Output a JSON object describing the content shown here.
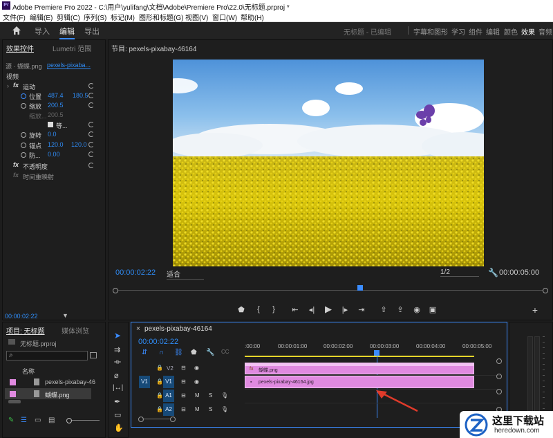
{
  "window": {
    "title": "Adobe Premiere Pro 2022 - C:\\用户\\yulifang\\文档\\Adobe\\Premiere Pro\\22.0\\无标题.prproj *",
    "app_icon": "Pr"
  },
  "menu": [
    "文件(F)",
    "编辑(E)",
    "剪辑(C)",
    "序列(S)",
    "标记(M)",
    "图形和标题(G)",
    "视图(V)",
    "窗口(W)",
    "帮助(H)"
  ],
  "workspace": {
    "tabs": [
      "导入",
      "编辑",
      "导出"
    ],
    "active_tab": "编辑",
    "project_status": "无标题 - 已编辑",
    "right_tabs": [
      "字幕和图形",
      "学习",
      "组件",
      "编辑",
      "颜色",
      "效果",
      "音频"
    ],
    "right_active": "效果"
  },
  "effect_controls": {
    "tabs": [
      "效果控件",
      "Lumetri 范围"
    ],
    "source": "源 · 蝴蝶.png",
    "seq": "pexels-pixaba...",
    "section": "视频",
    "motion": "运动",
    "properties": [
      {
        "label": "位置",
        "v1": "487.4",
        "v2": "180.5"
      },
      {
        "label": "缩放",
        "v1": "200.5"
      },
      {
        "label": "缩放...",
        "v1": "200.5"
      },
      {
        "label": "等...",
        "v1": ""
      },
      {
        "label": "旋转",
        "v1": "0.0"
      },
      {
        "label": "锚点",
        "v1": "120.0",
        "v2": "120.0"
      },
      {
        "label": "防...",
        "v1": "0.00"
      }
    ],
    "opacity": "不透明度",
    "time_remap": "时间重映射",
    "timecode": "00:00:02:22"
  },
  "program": {
    "label": "节目: pexels-pixabay-46164",
    "timecode": "00:00:02:22",
    "fit": "适合",
    "quality": "1/2",
    "duration": "00:00:05:00"
  },
  "project": {
    "tabs": [
      "项目: 无标题",
      "媒体浏览"
    ],
    "file": "无标题.prproj",
    "search_placeholder": "",
    "name_header": "名称",
    "items": [
      {
        "name": "pexels-pixabay-46",
        "color": "#e08ae0"
      },
      {
        "name": "蝴蝶.png",
        "color": "#e08ae0"
      }
    ]
  },
  "timeline": {
    "tab": "pexels-pixabay-46164",
    "timecode": "00:00:02:22",
    "ruler": [
      ":00:00",
      "00:00:01:00",
      "00:00:02:00",
      "00:00:03:00",
      "00:00:04:00",
      "00:00:05:00"
    ],
    "tracks": [
      {
        "id": "V2",
        "src": ""
      },
      {
        "id": "V1",
        "src": "V1"
      },
      {
        "id": "A1",
        "src": "A1"
      },
      {
        "id": "A2",
        "src": "A2"
      }
    ],
    "track_buttons": [
      "M",
      "S"
    ],
    "clips": [
      {
        "track": "V2",
        "name": "蝴蝶.png"
      },
      {
        "track": "V1",
        "name": "pexels-pixabay-46164.jpg"
      }
    ]
  },
  "watermark": {
    "title": "这里下载站",
    "url": "heredown.com"
  }
}
